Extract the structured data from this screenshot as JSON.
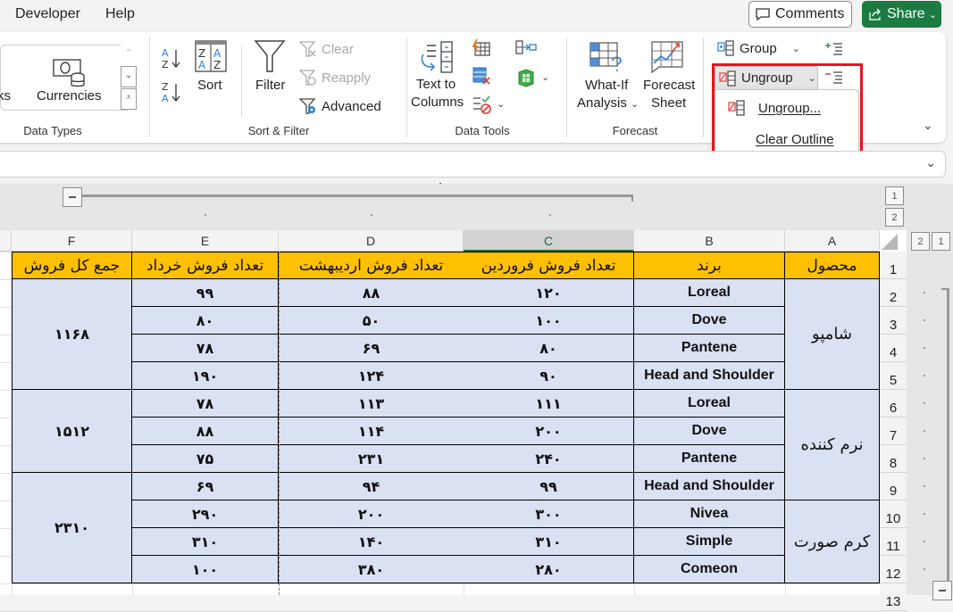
{
  "menubar": {
    "tabs": [
      "Developer",
      "Help"
    ],
    "comments_label": "Comments",
    "share_label": "Share"
  },
  "ribbon": {
    "data_types": {
      "partial_label": "ks",
      "currencies_label": "Currencies",
      "group_label": "Data Types"
    },
    "sort_filter": {
      "sort_label": "Sort",
      "filter_label": "Filter",
      "clear_label": "Clear",
      "reapply_label": "Reapply",
      "advanced_label": "Advanced",
      "group_label": "Sort & Filter"
    },
    "data_tools": {
      "text_to_columns_line1": "Text to",
      "text_to_columns_line2": "Columns",
      "group_label": "Data Tools"
    },
    "forecast": {
      "what_if_line1": "What-If",
      "what_if_line2": "Analysis",
      "forecast_line1": "Forecast",
      "forecast_line2": "Sheet",
      "group_label": "Forecast"
    },
    "outline": {
      "group_label_text": "Group",
      "ungroup_label": "Ungroup"
    }
  },
  "ungroup_menu": {
    "items": [
      "Ungroup...",
      "Clear Outline"
    ],
    "accent_color": "#e8141e"
  },
  "outline": {
    "column_levels": [
      "1",
      "2"
    ],
    "row_levels": [
      "2",
      "1"
    ]
  },
  "sheet": {
    "columns": [
      "F",
      "E",
      "D",
      "C",
      "B",
      "A"
    ],
    "selected_column": "C",
    "row_numbers": [
      "1",
      "2",
      "3",
      "4",
      "5",
      "6",
      "7",
      "8",
      "9",
      "10",
      "11",
      "12",
      "13"
    ],
    "header": {
      "product": "محصول",
      "brand": "برند",
      "farvardin": "تعداد فروش فروردین",
      "ordibehesht": "تعداد فروش اردیبهشت",
      "khordad": "تعداد فروش خرداد",
      "total": "جمع کل فروش"
    },
    "rows": [
      {
        "brand": "Loreal",
        "farvardin": "۱۲۰",
        "ordibehesht": "۸۸",
        "khordad": "۹۹"
      },
      {
        "brand": "Dove",
        "farvardin": "۱۰۰",
        "ordibehesht": "۵۰",
        "khordad": "۸۰"
      },
      {
        "brand": "Pantene",
        "farvardin": "۸۰",
        "ordibehesht": "۶۹",
        "khordad": "۷۸"
      },
      {
        "brand": "Head and Shoulder",
        "farvardin": "۹۰",
        "ordibehesht": "۱۲۴",
        "khordad": "۱۹۰"
      },
      {
        "brand": "Loreal",
        "farvardin": "۱۱۱",
        "ordibehesht": "۱۱۳",
        "khordad": "۷۸"
      },
      {
        "brand": "Dove",
        "farvardin": "۲۰۰",
        "ordibehesht": "۱۱۴",
        "khordad": "۸۸"
      },
      {
        "brand": "Pantene",
        "farvardin": "۲۴۰",
        "ordibehesht": "۲۳۱",
        "khordad": "۷۵"
      },
      {
        "brand": "Head and Shoulder",
        "farvardin": "۹۹",
        "ordibehesht": "۹۴",
        "khordad": "۶۹"
      },
      {
        "brand": "Nivea",
        "farvardin": "۳۰۰",
        "ordibehesht": "۲۰۰",
        "khordad": "۲۹۰"
      },
      {
        "brand": "Simple",
        "farvardin": "۳۱۰",
        "ordibehesht": "۱۴۰",
        "khordad": "۳۱۰"
      },
      {
        "brand": "Comeon",
        "farvardin": "۲۸۰",
        "ordibehesht": "۳۸۰",
        "khordad": "۱۰۰"
      }
    ],
    "products": [
      "شامپو",
      "نرم کننده",
      "کرم صورت"
    ],
    "totals": [
      "۱۱۶۸",
      "۱۵۱۲",
      "۲۳۱۰"
    ]
  }
}
